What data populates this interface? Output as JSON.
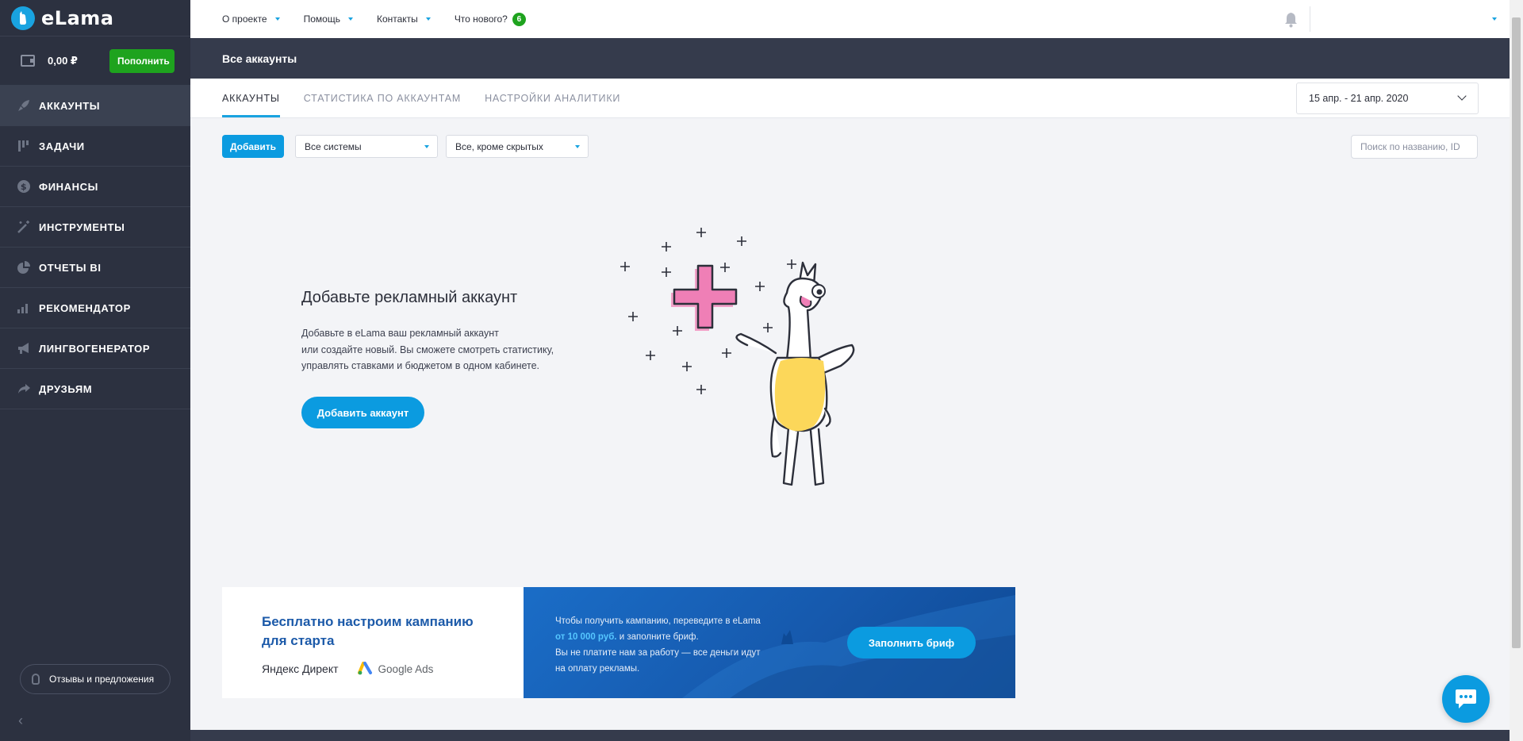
{
  "brand": {
    "name": "eLama",
    "color": "#19a3e0"
  },
  "sidebar": {
    "balance": "0,00 ₽",
    "topup_label": "Пополнить",
    "items": [
      {
        "label": "АККАУНТЫ",
        "icon": "rocket-icon",
        "active": true
      },
      {
        "label": "ЗАДАЧИ",
        "icon": "tasks-icon"
      },
      {
        "label": "ФИНАНСЫ",
        "icon": "dollar-icon"
      },
      {
        "label": "ИНСТРУМЕНТЫ",
        "icon": "magic-wand-icon"
      },
      {
        "label": "ОТЧЕТЫ BI",
        "icon": "pie-chart-icon"
      },
      {
        "label": "РЕКОМЕНДАТОР",
        "icon": "bar-chart-icon"
      },
      {
        "label": "ЛИНГВОГЕНЕРАТОР",
        "icon": "megaphone-icon"
      },
      {
        "label": "ДРУЗЬЯМ",
        "icon": "share-icon"
      }
    ],
    "feedback_label": "Отзывы и предложения"
  },
  "topbar": {
    "links": [
      "О проекте",
      "Помощь",
      "Контакты"
    ],
    "whats_new_label": "Что нового?",
    "whats_new_count": "6"
  },
  "page": {
    "title": "Все аккаунты",
    "tabs": [
      "АККАУНТЫ",
      "СТАТИСТИКА ПО АККАУНТАМ",
      "НАСТРОЙКИ АНАЛИТИКИ"
    ],
    "date_range": "15 апр. - 21 апр. 2020"
  },
  "toolbar": {
    "add_label": "Добавить",
    "systems_filter": "Все системы",
    "visibility_filter": "Все, кроме скрытых",
    "search_placeholder": "Поиск по названию, ID"
  },
  "empty_state": {
    "title": "Добавьте рекламный аккаунт",
    "description_line1": "Добавьте в eLama ваш рекламный аккаунт",
    "description_line2": "или создайте новый. Вы сможете смотреть статистику,",
    "description_line3": "управлять ставками и бюджетом в одном кабинете.",
    "button_label": "Добавить аккаунт"
  },
  "banner": {
    "title_line1": "Бесплатно настроим кампанию",
    "title_line2": "для старта",
    "partner1": "Яндекс Директ",
    "partner2": "Google Ads",
    "text_line1": "Чтобы получить кампанию, переведите в eLama",
    "text_highlight": "от 10 000 руб.",
    "text_line2_rest": " и заполните бриф.",
    "text_line3": "Вы не платите нам за работу — все деньги идут",
    "text_line4": "на оплату рекламы.",
    "button_label": "Заполнить бриф"
  }
}
